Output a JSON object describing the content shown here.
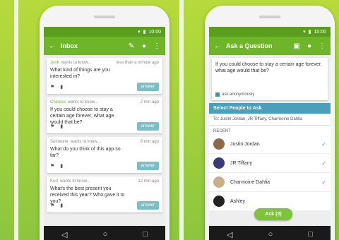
{
  "left_phone": {
    "status_time": "10:00",
    "toolbar": {
      "back_icon": "back-arrow-icon",
      "title": "Inbox",
      "compose_icon": "compose-icon",
      "profile_icon": "person-icon",
      "menu_icon": "overflow-menu-icon"
    },
    "cards": [
      {
        "name": "Jenk",
        "wants": "wants to know...",
        "time": "less than a minute ago",
        "question": "What kind of things are you interested in?",
        "answer_label": "answer"
      },
      {
        "name": "Chinese",
        "wants": "wants to know...",
        "time": "2 min ago",
        "question": "If you could choose to stay a certain age forever, what age would that be?",
        "answer_label": "answer"
      },
      {
        "name": "Someone",
        "wants": "wants to know...",
        "time": "8 min ago",
        "question": "What do you think of this app so far?",
        "answer_label": "answer"
      },
      {
        "name": "Kurt",
        "wants": "wants to know...",
        "time": "12 min ago",
        "question": "What's the best present you received this year? Who gave it to you?",
        "answer_label": "answer"
      }
    ]
  },
  "right_phone": {
    "status_time": "10:00",
    "toolbar": {
      "title": "Ask a Question"
    },
    "question_text": "If you could choose to stay a certain age forever, what age would that be?",
    "anon_label": "ask anonymously",
    "select_header": "Select People to Ask",
    "to_line": "To:  Justin Jordan, JR Tiffany, Charmoine Dahlia",
    "recent_label": "RECENT",
    "people": [
      {
        "name": "Justin Jordan",
        "avatar_color": "#8a6a4a"
      },
      {
        "name": "JR Tiffany",
        "avatar_color": "#3a3a7a"
      },
      {
        "name": "Charmoine Dahlia",
        "avatar_color": "#c8b08a"
      },
      {
        "name": "Ashley",
        "avatar_color": "#222222"
      }
    ],
    "ask_button": "Ask (3)"
  },
  "colors": {
    "toolbar": "#6fb52a",
    "accent_blue": "#4aa0b8",
    "background": "#a4d23c"
  }
}
